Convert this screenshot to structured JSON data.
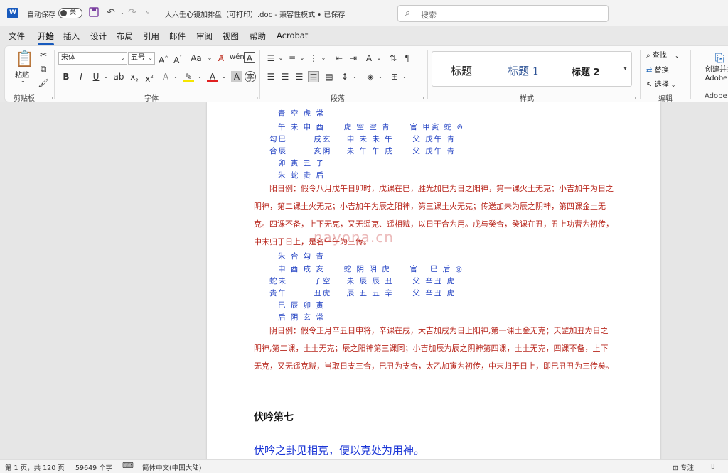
{
  "titlebar": {
    "autosave_label": "自动保存",
    "autosave_state": "关",
    "document_title": "大六壬心镜加排盘（可打印）.doc  -  兼容性模式 • 已保存 ",
    "search_placeholder": "搜索"
  },
  "tabs": [
    "文件",
    "开始",
    "插入",
    "设计",
    "布局",
    "引用",
    "邮件",
    "审阅",
    "视图",
    "帮助",
    "Acrobat"
  ],
  "ribbon": {
    "clipboard": {
      "paste_label": "粘贴",
      "group_label": "剪贴板"
    },
    "font": {
      "font_name": "宋体",
      "font_size": "五号",
      "group_label": "字体"
    },
    "paragraph": {
      "group_label": "段落"
    },
    "styles": {
      "items": [
        "标题",
        "标题 1",
        "标题 2"
      ],
      "group_label": "样式"
    },
    "editing": {
      "find": "查找",
      "replace": "替换",
      "select": "选择",
      "group_label": "编辑"
    },
    "adobe": {
      "line1": "创建并共",
      "line2": "Adobe P",
      "group_label": "Adobe"
    }
  },
  "document": {
    "block1": [
      "青 空 虎 常",
      "午 未 申 酉     虎 空 空 青     官 甲寅 蛇 ⊙",
      "勾巳       戌玄    申 未 未 午     父 戊午 青",
      "合辰       亥阴    未 午 午 戌     父 戊午 青",
      "卯 寅 丑 子",
      "朱 蛇 贵 后"
    ],
    "para1": "阳日例：假令八月戊午日卯时，戊课在巳，胜光加巳为日之阳神，第一课火土无克；小吉加午为日之阴神，第二课土火无克；小吉加午为辰之阳神，第三课土火无克；传送加未为辰之阴神，第四课金土无克。四课不备，上下无克，又无遥克、遥相贼，以日干合为用。戊与癸合，癸课在丑，丑上功曹为初传，中末归于日上，是名午午为三传。",
    "block2": [
      "朱 合 勾 青",
      "申 酉 戌 亥     蛇 阴 阴 虎     官   巳 后 ◎",
      "蛇未       子空    未 辰 辰 丑     父 辛丑 虎",
      "贵午       丑虎    辰 丑 丑 辛     父 辛丑 虎",
      "巳 辰 卯 寅",
      "后 阴 玄 常"
    ],
    "para2": "阴日例：假令正月辛丑日申将，辛课在戌，大吉加戌为日上阳神,第一课土金无克；天罡加丑为日之阴神,第二课，土土无克；辰之阳神第三课同；小吉加辰为辰之阴神第四课，土土无克，四课不备，上下无克，又无遥克贼，当取日支三合，巳丑为支合，太乙加寅为初传，中末归于日上，即巳丑丑为三传矣。",
    "heading": "伏吟第七",
    "blue_heading": "伏吟之卦见相克，便以克处为用神。",
    "watermark": "nayona.cn"
  },
  "statusbar": {
    "page": "第 1 页，共 120 页",
    "words": "59649 个字",
    "language": "简体中文(中国大陆)",
    "focus": "专注"
  }
}
